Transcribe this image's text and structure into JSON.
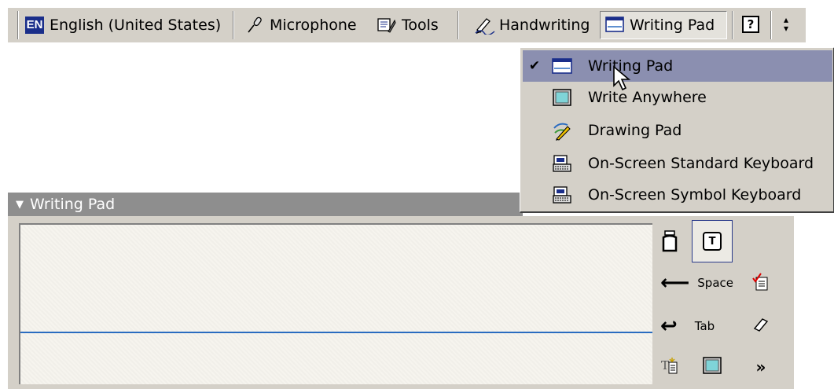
{
  "language_bar": {
    "language_code": "EN",
    "language": "English (United States)",
    "microphone": "Microphone",
    "tools": "Tools",
    "handwriting": "Handwriting",
    "writing_pad": "Writing Pad",
    "help_glyph": "?"
  },
  "menu": {
    "items": [
      {
        "label": "Writing Pad",
        "checked": true,
        "icon": "writing-pad-icon"
      },
      {
        "label": "Write Anywhere",
        "checked": false,
        "icon": "write-anywhere-icon"
      },
      {
        "label": "Drawing Pad",
        "checked": false,
        "icon": "drawing-pad-icon"
      },
      {
        "label": "On-Screen Standard Keyboard",
        "checked": false,
        "icon": "keyboard-icon"
      },
      {
        "label": "On-Screen Symbol Keyboard",
        "checked": false,
        "icon": "keyboard-icon"
      }
    ],
    "check_glyph": "✔"
  },
  "pad": {
    "title": "Writing Pad",
    "space_label": "Space",
    "tab_label": "Tab",
    "more_glyph": "»",
    "text_mode_glyph": "T"
  },
  "colors": {
    "menu_highlight": "#8b8fb0",
    "baseline": "#2a6cc0",
    "title_bar": "#8e8e8e",
    "face": "#d4d0c8"
  }
}
